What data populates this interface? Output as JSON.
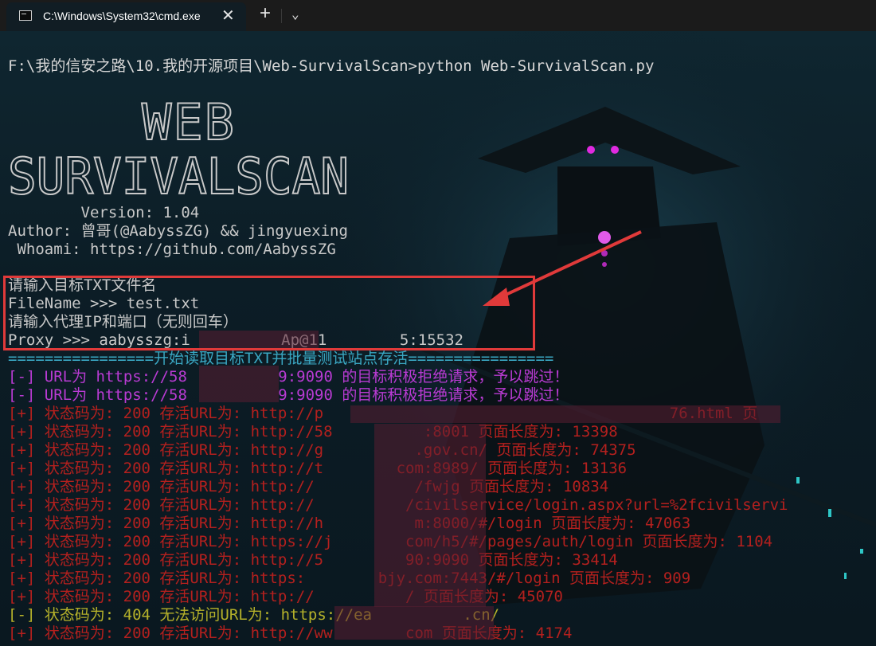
{
  "window": {
    "tab_title": "C:\\Windows\\System32\\cmd.exe",
    "close_glyph": "✕",
    "new_tab_glyph": "+",
    "dropdown_glyph": "⌄"
  },
  "terminal": {
    "command": "F:\\我的信安之路\\10.我的开源项目\\Web-SurvivalScan>python Web-SurvivalScan.py",
    "logo_line1": "WEB",
    "logo_line2": "SURVIVALSCAN",
    "version": "        Version: 1.04",
    "author": "Author: 曾哥(@AabyssZG) && jingyuexing",
    "whoami": " Whoami: https://github.com/AabyssZG",
    "prompt_file": "请输入目标TXT文件名",
    "filename": "FileName >>> test.txt",
    "prompt_proxy": "请输入代理IP和端口（无则回车）",
    "proxy": "Proxy >>> aabysszg:i          Ap@11        5:15532",
    "banner": "================开始读取目标TXT并批量测试站点存活================",
    "results": [
      {
        "cls": "mag",
        "text": "[-] URL为 https://58          9:9090 的目标积极拒绝请求，予以跳过！"
      },
      {
        "cls": "mag",
        "text": "[-] URL为 https://58          9:9090 的目标积极拒绝请求，予以跳过！"
      },
      {
        "cls": "red",
        "text": "[+] 状态码为: 200 存活URL为: http://p                                      76.html 页"
      },
      {
        "cls": "red",
        "text": "[+] 状态码为: 200 存活URL为: http://58          :8001 页面长度为: 13398"
      },
      {
        "cls": "red",
        "text": "[+] 状态码为: 200 存活URL为: http://g          .gov.cn/ 页面长度为: 74375"
      },
      {
        "cls": "red",
        "text": "[+] 状态码为: 200 存活URL为: http://t        com:8989/ 页面长度为: 13136"
      },
      {
        "cls": "red",
        "text": "[+] 状态码为: 200 存活URL为: http://           /fwjg 页面长度为: 10834"
      },
      {
        "cls": "red",
        "text": "[+] 状态码为: 200 存活URL为: http://          /civilservice/login.aspx?url=%2fcivilservi"
      },
      {
        "cls": "red",
        "text": "[+] 状态码为: 200 存活URL为: http://h          m:8000/#/login 页面长度为: 47063"
      },
      {
        "cls": "red",
        "text": "[+] 状态码为: 200 存活URL为: https://j        com/h5/#/pages/auth/login 页面长度为: 1104"
      },
      {
        "cls": "red",
        "text": "[+] 状态码为: 200 存活URL为: http://5         90:9090 页面长度为: 33414"
      },
      {
        "cls": "red",
        "text": "[+] 状态码为: 200 存活URL为: https:        bjy.com:7443/#/login 页面长度为: 909"
      },
      {
        "cls": "red",
        "text": "[+] 状态码为: 200 存活URL为: http://          / 页面长度为: 45070"
      },
      {
        "cls": "yel",
        "text": "[-] 状态码为: 404 无法访问URL为: https://ea          .cn/"
      },
      {
        "cls": "red",
        "text": "[+] 状态码为: 200 存活URL为: http://ww        com 页面长度为: 4174"
      }
    ]
  },
  "colors": {
    "error": "#b4201e",
    "refused": "#b93bd3",
    "notfound": "#b5b12a",
    "banner": "#3aa7c2",
    "highlight": "#e03a3a"
  }
}
